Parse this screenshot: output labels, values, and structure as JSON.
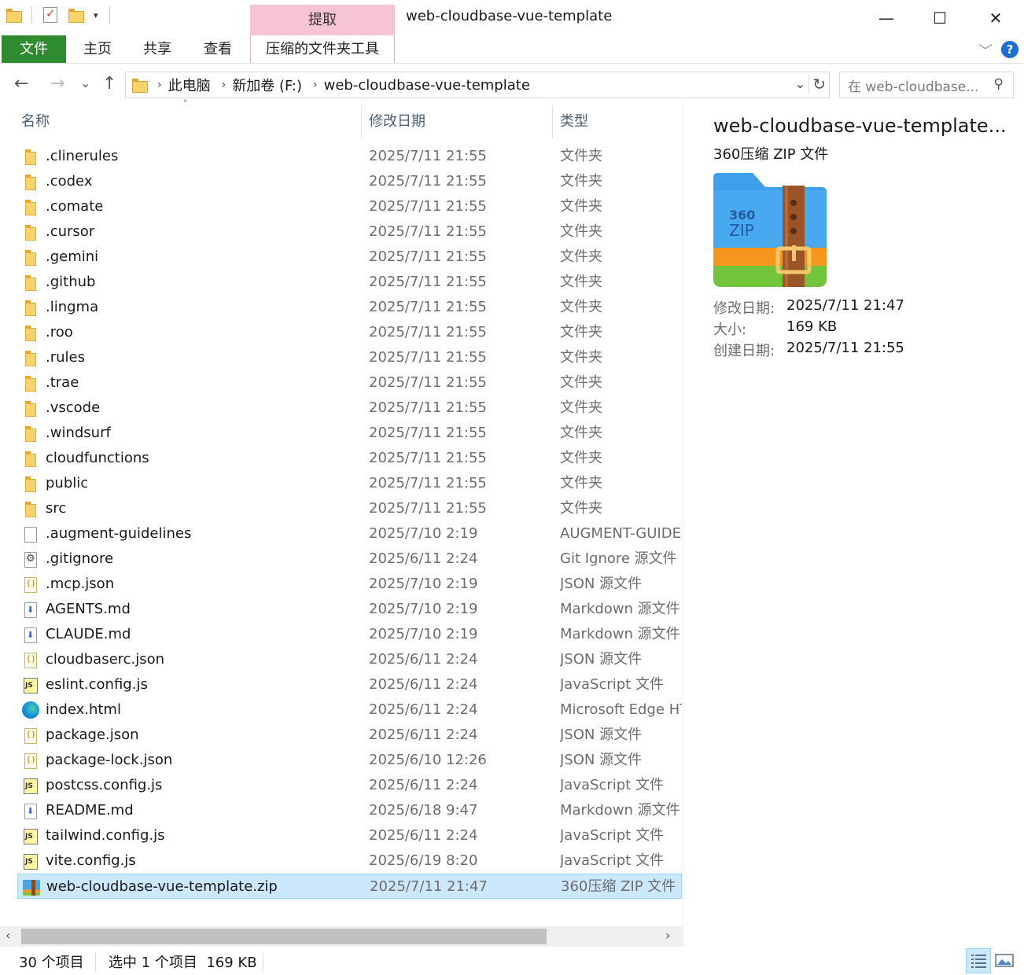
{
  "window": {
    "title": "web-cloudbase-vue-template",
    "context_tab": "提取",
    "minimize": "—",
    "maximize": "☐",
    "close": "✕"
  },
  "ribbon": {
    "tabs": [
      "文件",
      "主页",
      "共享",
      "查看",
      "压缩的文件夹工具"
    ],
    "help": "?"
  },
  "nav": {
    "back": "←",
    "forward": "→",
    "recent": "⌄",
    "up": "↑",
    "breadcrumb": [
      "此电脑",
      "新加卷 (F:)",
      "web-cloudbase-vue-template"
    ],
    "search_placeholder": "在 web-cloudbase..."
  },
  "columns": {
    "name": "名称",
    "date": "修改日期",
    "type": "类型"
  },
  "files": [
    {
      "name": ".clinerules",
      "date": "2025/7/11 21:55",
      "type": "文件夹",
      "icon": "folder"
    },
    {
      "name": ".codex",
      "date": "2025/7/11 21:55",
      "type": "文件夹",
      "icon": "folder"
    },
    {
      "name": ".comate",
      "date": "2025/7/11 21:55",
      "type": "文件夹",
      "icon": "folder"
    },
    {
      "name": ".cursor",
      "date": "2025/7/11 21:55",
      "type": "文件夹",
      "icon": "folder"
    },
    {
      "name": ".gemini",
      "date": "2025/7/11 21:55",
      "type": "文件夹",
      "icon": "folder"
    },
    {
      "name": ".github",
      "date": "2025/7/11 21:55",
      "type": "文件夹",
      "icon": "folder"
    },
    {
      "name": ".lingma",
      "date": "2025/7/11 21:55",
      "type": "文件夹",
      "icon": "folder"
    },
    {
      "name": ".roo",
      "date": "2025/7/11 21:55",
      "type": "文件夹",
      "icon": "folder"
    },
    {
      "name": ".rules",
      "date": "2025/7/11 21:55",
      "type": "文件夹",
      "icon": "folder"
    },
    {
      "name": ".trae",
      "date": "2025/7/11 21:55",
      "type": "文件夹",
      "icon": "folder"
    },
    {
      "name": ".vscode",
      "date": "2025/7/11 21:55",
      "type": "文件夹",
      "icon": "folder"
    },
    {
      "name": ".windsurf",
      "date": "2025/7/11 21:55",
      "type": "文件夹",
      "icon": "folder"
    },
    {
      "name": "cloudfunctions",
      "date": "2025/7/11 21:55",
      "type": "文件夹",
      "icon": "folder"
    },
    {
      "name": "public",
      "date": "2025/7/11 21:55",
      "type": "文件夹",
      "icon": "folder"
    },
    {
      "name": "src",
      "date": "2025/7/11 21:55",
      "type": "文件夹",
      "icon": "folder"
    },
    {
      "name": ".augment-guidelines",
      "date": "2025/7/10 2:19",
      "type": "AUGMENT-GUIDELINES",
      "icon": "doc"
    },
    {
      "name": ".gitignore",
      "date": "2025/6/11 2:24",
      "type": "Git Ignore 源文件",
      "icon": "gear"
    },
    {
      "name": ".mcp.json",
      "date": "2025/7/10 2:19",
      "type": "JSON 源文件",
      "icon": "json"
    },
    {
      "name": "AGENTS.md",
      "date": "2025/7/10 2:19",
      "type": "Markdown 源文件",
      "icon": "md"
    },
    {
      "name": "CLAUDE.md",
      "date": "2025/7/10 2:19",
      "type": "Markdown 源文件",
      "icon": "md"
    },
    {
      "name": "cloudbaserc.json",
      "date": "2025/6/11 2:24",
      "type": "JSON 源文件",
      "icon": "json"
    },
    {
      "name": "eslint.config.js",
      "date": "2025/6/11 2:24",
      "type": "JavaScript 文件",
      "icon": "js"
    },
    {
      "name": "index.html",
      "date": "2025/6/11 2:24",
      "type": "Microsoft Edge HTML",
      "icon": "edge"
    },
    {
      "name": "package.json",
      "date": "2025/6/11 2:24",
      "type": "JSON 源文件",
      "icon": "json"
    },
    {
      "name": "package-lock.json",
      "date": "2025/6/10 12:26",
      "type": "JSON 源文件",
      "icon": "json"
    },
    {
      "name": "postcss.config.js",
      "date": "2025/6/11 2:24",
      "type": "JavaScript 文件",
      "icon": "js"
    },
    {
      "name": "README.md",
      "date": "2025/6/18 9:47",
      "type": "Markdown 源文件",
      "icon": "md"
    },
    {
      "name": "tailwind.config.js",
      "date": "2025/6/11 2:24",
      "type": "JavaScript 文件",
      "icon": "js"
    },
    {
      "name": "vite.config.js",
      "date": "2025/6/19 8:20",
      "type": "JavaScript 文件",
      "icon": "js"
    },
    {
      "name": "web-cloudbase-vue-template.zip",
      "date": "2025/7/11 21:47",
      "type": "360压缩 ZIP 文件",
      "icon": "zip",
      "selected": true
    }
  ],
  "preview": {
    "title": "web-cloudbase-vue-template...",
    "subtitle": "360压缩 ZIP 文件",
    "icon_text_top": "360",
    "icon_text_bottom": "ZIP",
    "meta": [
      {
        "label": "修改日期:",
        "value": "2025/7/11 21:47"
      },
      {
        "label": "大小:",
        "value": "169 KB"
      },
      {
        "label": "创建日期:",
        "value": "2025/7/11 21:55"
      }
    ]
  },
  "status": {
    "count": "30 个项目",
    "selection": "选中 1 个项目  169 KB"
  },
  "colors": {
    "file_tab": "#2f8b2f",
    "context_tab": "#f7c3d6",
    "selection": "#cce8ff",
    "header_text": "#4c607a"
  }
}
